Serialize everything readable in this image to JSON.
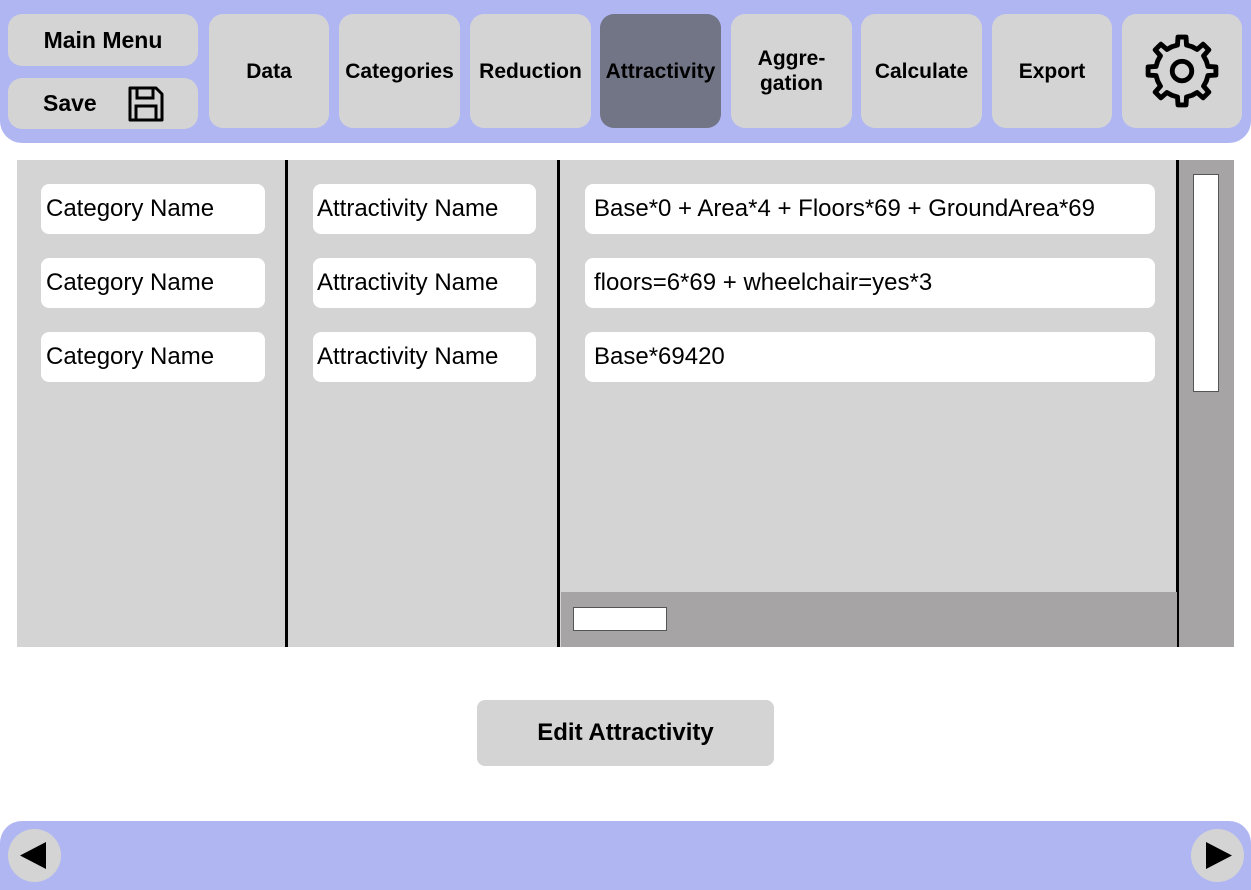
{
  "nav": {
    "main_menu": "Main Menu",
    "save": "Save",
    "tabs": [
      {
        "label": "Data",
        "active": false
      },
      {
        "label": "Categories",
        "active": false
      },
      {
        "label": "Reduction",
        "active": false
      },
      {
        "label": "Attractivity",
        "active": true
      },
      {
        "label": "Aggre-\ngation",
        "active": false
      },
      {
        "label": "Calculate",
        "active": false
      },
      {
        "label": "Export",
        "active": false
      }
    ]
  },
  "table": {
    "rows": [
      {
        "category": "Category Name",
        "attractivity": "Attractivity Name",
        "formula": "Base*0 + Area*4 + Floors*69 + GroundArea*69"
      },
      {
        "category": "Category Name",
        "attractivity": "Attractivity Name",
        "formula": "floors=6*69 + wheelchair=yes*3"
      },
      {
        "category": "Category Name",
        "attractivity": "Attractivity Name",
        "formula": "Base*69420"
      }
    ]
  },
  "actions": {
    "edit_attractivity": "Edit Attractivity"
  },
  "colors": {
    "bar": "#b0b6f2",
    "button": "#d4d4d4",
    "active_tab": "#727585",
    "scroll_track": "#a7a4a5"
  },
  "icons": {
    "save": "floppy-disk-icon",
    "settings": "gear-icon",
    "prev": "triangle-left-icon",
    "next": "triangle-right-icon"
  }
}
